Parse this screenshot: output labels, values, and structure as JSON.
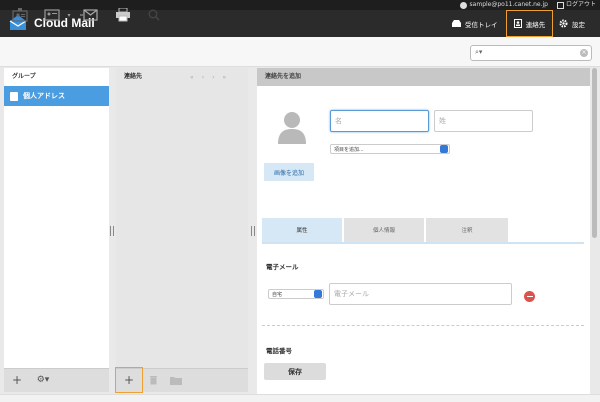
{
  "topbar": {
    "user_email": "sample@po11.canet.ne.jp",
    "logout_label": "ログアウト"
  },
  "header": {
    "app_name": "Cloud Mail",
    "inbox_label": "受信トレイ",
    "contacts_label": "連絡先",
    "settings_label": "設定",
    "accent_color": "#f0a030"
  },
  "toolbar": {
    "search_placeholder": ""
  },
  "groups": {
    "title": "グループ",
    "items": [
      {
        "label": "個人アドレス"
      }
    ]
  },
  "contacts": {
    "title": "連絡先",
    "pager": [
      "«",
      "‹",
      "›",
      "»"
    ]
  },
  "form": {
    "title": "連絡先を追加",
    "first_name_placeholder": "名",
    "last_name_placeholder": "姓",
    "add_field_option": "項目を追加...",
    "add_photo_label": "画像を追加",
    "tabs": [
      {
        "label": "属性"
      },
      {
        "label": "個人情報"
      },
      {
        "label": "注釈"
      }
    ],
    "email_section": "電子メール",
    "email_type": "自宅",
    "email_placeholder": "電子メール",
    "phone_section": "電話番号",
    "save_label": "保存"
  }
}
